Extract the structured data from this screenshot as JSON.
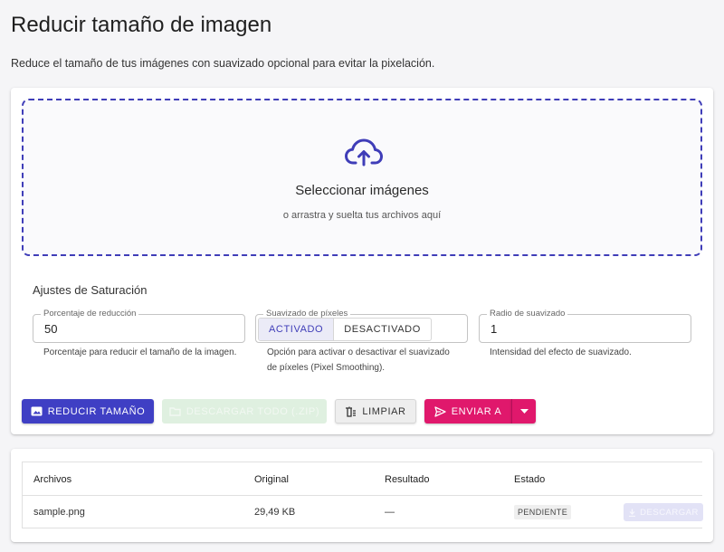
{
  "page": {
    "title": "Reducir tamaño de imagen",
    "description": "Reduce el tamaño de tus imágenes con suavizado opcional para evitar la pixelación."
  },
  "dropzone": {
    "title": "Seleccionar imágenes",
    "subtitle": "o arrastra y suelta tus archivos aquí",
    "icon": "cloud-upload-icon"
  },
  "settings": {
    "section_label": "Ajustes de Saturación",
    "reduction": {
      "label": "Porcentaje de reducción",
      "value": "50",
      "helper": "Porcentaje para reducir el tamaño de la imagen."
    },
    "smoothing": {
      "label": "Suavizado de píxeles",
      "options": [
        "ACTIVADO",
        "DESACTIVADO"
      ],
      "selected": "ACTIVADO",
      "helper_line1": "Opción para activar o desactivar el suavizado",
      "helper_line2": "de píxeles (Pixel Smoothing)."
    },
    "radius": {
      "label": "Radio de suavizado",
      "value": "1",
      "helper": "Intensidad del efecto de suavizado."
    }
  },
  "actions": {
    "reduce_label": "REDUCIR TAMAÑO",
    "download_all_label": "DESCARGAR TODO (.ZIP)",
    "clear_label": "LIMPIAR",
    "send_label": "ENVIAR A"
  },
  "files_table": {
    "headers": [
      "Archivos",
      "Original",
      "Resultado",
      "Estado"
    ],
    "rows": [
      {
        "file": "sample.png",
        "original": "29,49 KB",
        "result": "—",
        "status": "PENDIENTE",
        "download_label": "DESCARGAR"
      }
    ]
  },
  "colors": {
    "primary": "#3f3fc4",
    "accent": "#e0186c",
    "dropzone_border": "#3f3db8"
  }
}
